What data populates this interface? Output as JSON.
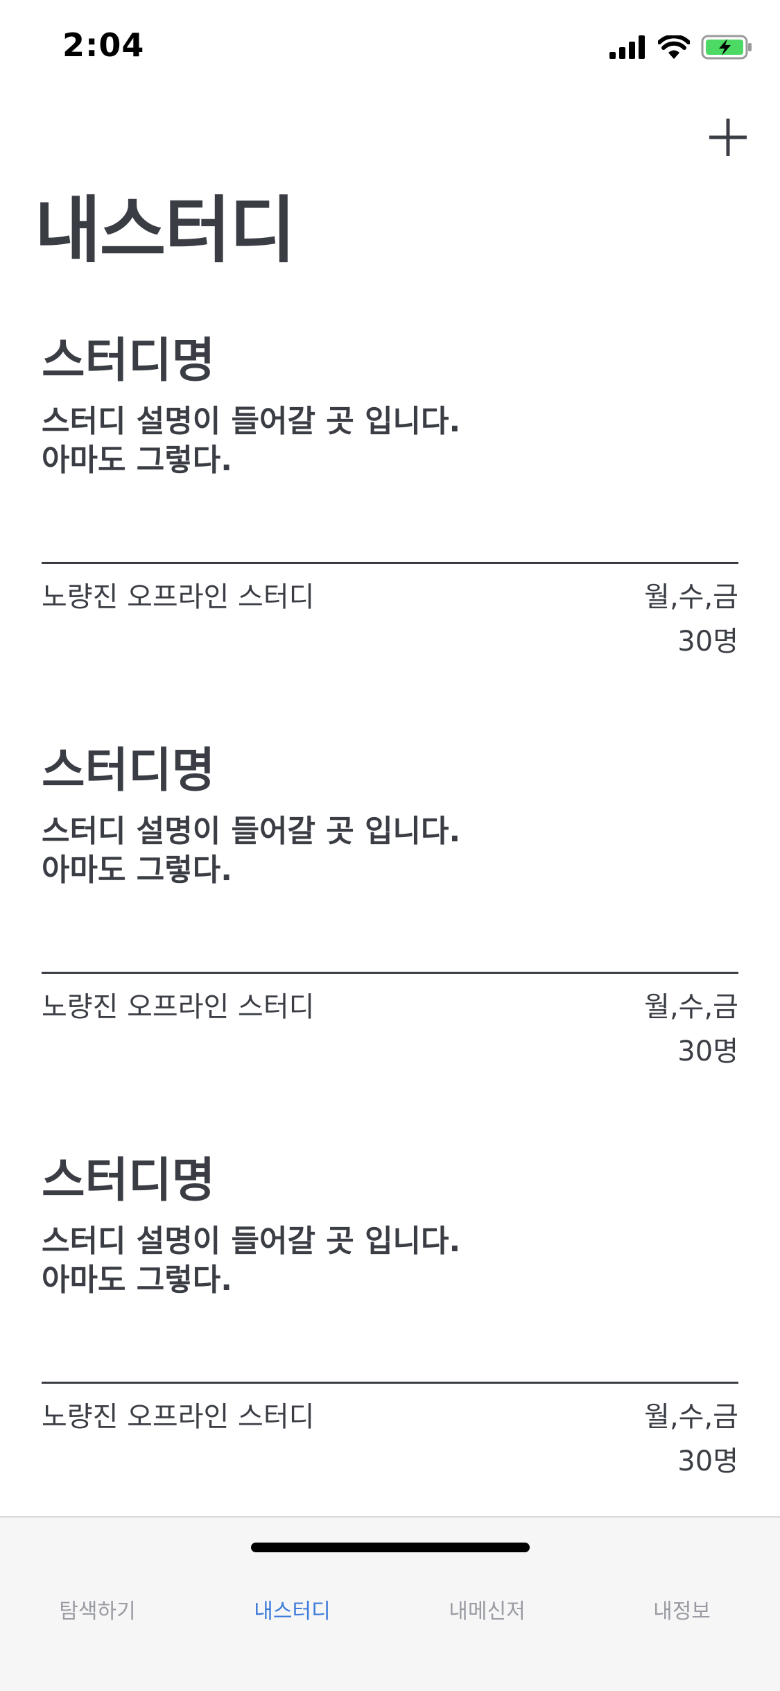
{
  "status_bar": {
    "time": "2:04",
    "icons": [
      "cellular-signal-icon",
      "wifi-icon",
      "battery-charging-icon"
    ],
    "battery_color": "#4cd964"
  },
  "header": {
    "add_icon": "plus-icon",
    "title": "내스터디"
  },
  "studies": [
    {
      "name": "스터디명",
      "description_lines": [
        "스터디 설명이 들어갈 곳 입니다.",
        "아마도 그렇다."
      ],
      "location": "노량진 오프라인 스터디",
      "days": "월,수,금",
      "members": "30명"
    },
    {
      "name": "스터디명",
      "description_lines": [
        "스터디 설명이 들어갈 곳 입니다.",
        "아마도 그렇다."
      ],
      "location": "노량진 오프라인 스터디",
      "days": "월,수,금",
      "members": "30명"
    },
    {
      "name": "스터디명",
      "description_lines": [
        "스터디 설명이 들어갈 곳 입니다.",
        "아마도 그렇다."
      ],
      "location": "노량진 오프라인 스터디",
      "days": "월,수,금",
      "members": "30명"
    }
  ],
  "tab_bar": {
    "tabs": [
      {
        "label": "탐색하기",
        "active": false
      },
      {
        "label": "내스터디",
        "active": true
      },
      {
        "label": "내메신저",
        "active": false
      },
      {
        "label": "내정보",
        "active": false
      }
    ],
    "active_color": "#3d7bd9",
    "inactive_color": "#9a9ca3"
  }
}
